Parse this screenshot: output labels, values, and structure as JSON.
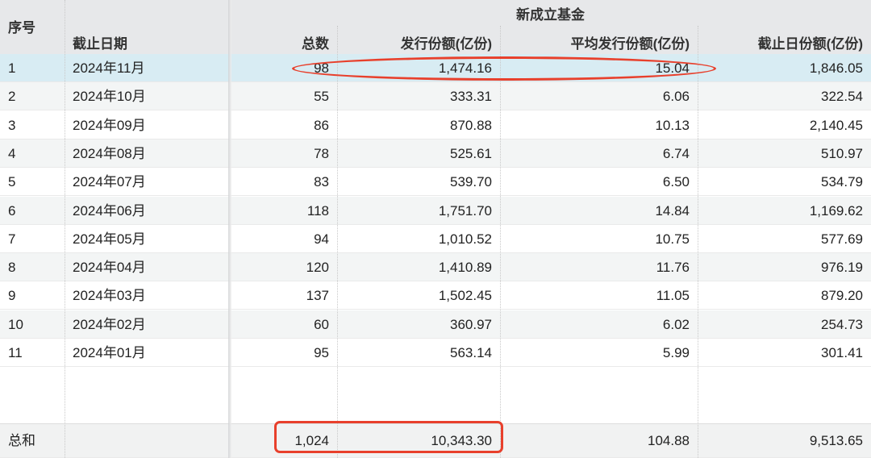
{
  "header": {
    "group": "新成立基金",
    "seq": "序号",
    "date": "截止日期",
    "total": "总数",
    "issue": "发行份额(亿份)",
    "avg": "平均发行份额(亿份)",
    "end": "截止日份额(亿份)"
  },
  "rows": [
    [
      "1",
      "2024年11月",
      "98",
      "1,474.16",
      "15.04",
      "1,846.05"
    ],
    [
      "2",
      "2024年10月",
      "55",
      "333.31",
      "6.06",
      "322.54"
    ],
    [
      "3",
      "2024年09月",
      "86",
      "870.88",
      "10.13",
      "2,140.45"
    ],
    [
      "4",
      "2024年08月",
      "78",
      "525.61",
      "6.74",
      "510.97"
    ],
    [
      "5",
      "2024年07月",
      "83",
      "539.70",
      "6.50",
      "534.79"
    ],
    [
      "6",
      "2024年06月",
      "118",
      "1,751.70",
      "14.84",
      "1,169.62"
    ],
    [
      "7",
      "2024年05月",
      "94",
      "1,010.52",
      "10.75",
      "577.69"
    ],
    [
      "8",
      "2024年04月",
      "120",
      "1,410.89",
      "11.76",
      "976.19"
    ],
    [
      "9",
      "2024年03月",
      "137",
      "1,502.45",
      "11.05",
      "879.20"
    ],
    [
      "10",
      "2024年02月",
      "60",
      "360.97",
      "6.02",
      "254.73"
    ],
    [
      "11",
      "2024年01月",
      "95",
      "563.14",
      "5.99",
      "301.41"
    ]
  ],
  "footer": {
    "label": "总和",
    "total": "1,024",
    "issue": "10,343.30",
    "avg": "104.88",
    "end": "9,513.65"
  },
  "colors": {
    "selected": "#d8ecf3",
    "highlight": "#e8402c",
    "header": "#e7e8ea"
  }
}
